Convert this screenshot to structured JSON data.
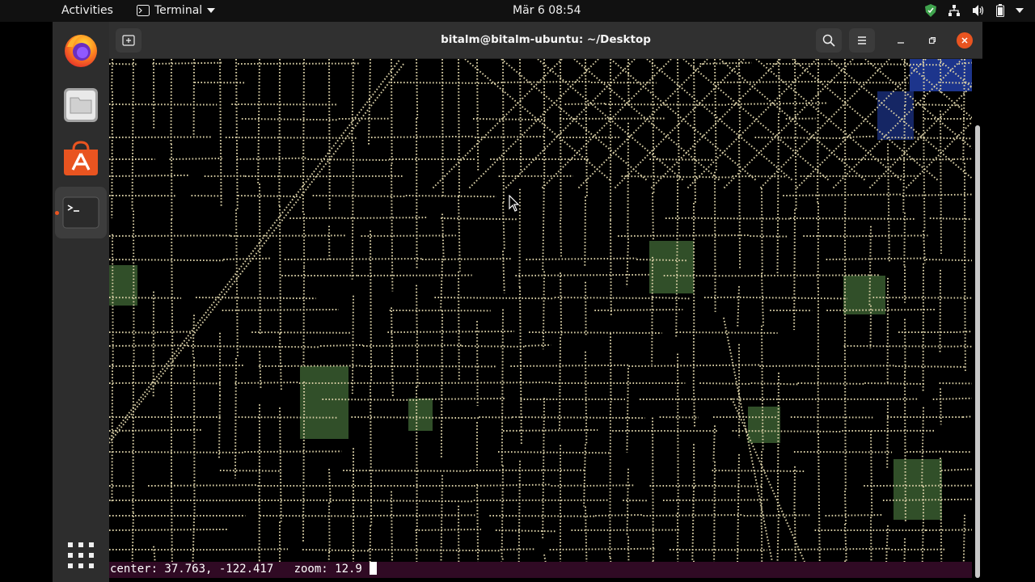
{
  "topbar": {
    "activities": "Activities",
    "app_name": "Terminal",
    "clock": "Mär 6  08:54"
  },
  "dock": {
    "items": [
      {
        "name": "Firefox",
        "icon": "firefox-icon"
      },
      {
        "name": "Files",
        "icon": "files-icon"
      },
      {
        "name": "Ubuntu Software",
        "icon": "software-center-icon"
      },
      {
        "name": "Terminal",
        "icon": "terminal-icon",
        "active": true
      }
    ],
    "apps_grid_icon": "show-apps-icon"
  },
  "window": {
    "title": "bitalm@bitalm-ubuntu: ~/Desktop"
  },
  "terminal": {
    "status_text": "center: 37.763, -122.417   zoom: 12.9",
    "map_colors": {
      "streets": "#d9cfa6",
      "parks": "#5a8f4a",
      "water": "#2a4cc8",
      "background": "#000000"
    }
  },
  "colors": {
    "accent": "#e95420",
    "terminal_bg": "#300a24",
    "close_button": "#e95420"
  }
}
